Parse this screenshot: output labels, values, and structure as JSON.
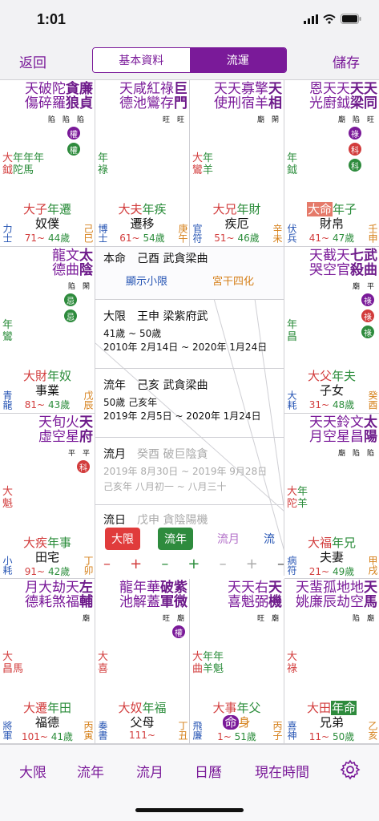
{
  "status": {
    "time": "1:01"
  },
  "nav": {
    "back": "返回",
    "save": "儲存",
    "seg": [
      "基本資料",
      "流運"
    ]
  },
  "cells": [
    {
      "id": "c0",
      "stars": [
        [
          "廉",
          "陷"
        ],
        [
          "貪",
          "陷"
        ],
        [
          "羅",
          "陷"
        ],
        [
          "破",
          ""
        ],
        [
          "天",
          ""
        ]
      ],
      "stars2": [
        [
          "貞",
          ""
        ],
        [
          "狼",
          ""
        ],
        [
          "碎",
          ""
        ],
        [
          "陀",
          ""
        ],
        [
          "傷",
          ""
        ]
      ],
      "badges": [
        "權",
        "權"
      ],
      "small": [
        "大年年年",
        "鉞陀馬"
      ],
      "palace": "大子年遷",
      "name": "奴僕",
      "age": "71~ 44歲",
      "bl": "力士",
      "br": "己巳"
    },
    {
      "id": "c1",
      "stars": [
        [
          "巨",
          "旺"
        ],
        [
          "祿",
          "旺"
        ],
        [
          "存",
          ""
        ],
        [
          "咸",
          ""
        ],
        [
          "天",
          ""
        ]
      ],
      "palace": "大夫年疾",
      "name": "遷移",
      "age": "61~ 54歲",
      "bl": "博士",
      "br": "庚午"
    },
    {
      "id": "c2",
      "stars": [
        [
          "天",
          "閑"
        ],
        [
          "相",
          "廟"
        ],
        [
          "擎",
          ""
        ],
        [
          "寡",
          ""
        ],
        [
          "天",
          ""
        ]
      ],
      "palace": "大兄年財",
      "name": "疾厄",
      "age": "51~ 46歲",
      "bl": "官符",
      "br": "辛未"
    },
    {
      "id": "c3",
      "stars": [
        [
          "天",
          "閑"
        ],
        [
          "同",
          "陷"
        ],
        [
          "天",
          "廟"
        ],
        [
          "梁",
          ""
        ],
        [
          "恩",
          ""
        ]
      ],
      "palace": "大命年子",
      "name": "財帛",
      "age": "41~ 47歲",
      "bl": "伏兵",
      "br": "壬申"
    },
    {
      "id": "c4",
      "stars": [
        [
          "太",
          "閑"
        ],
        [
          "陰",
          ""
        ],
        [
          "文",
          "陷"
        ],
        [
          "曲",
          ""
        ],
        [
          "龍",
          ""
        ]
      ],
      "palace": "大財年奴",
      "name": "事業",
      "age": "81~ 43歲",
      "bl": "青龍",
      "br": "戊辰"
    },
    {
      "id": "c5",
      "stars": [
        [
          "七",
          "廟"
        ],
        [
          "殺",
          ""
        ],
        [
          "武",
          "平"
        ],
        [
          "曲",
          ""
        ],
        [
          "天",
          ""
        ]
      ],
      "palace": "大父年夫",
      "name": "子女",
      "age": "31~ 48歲",
      "bl": "大耗",
      "br": "癸酉"
    },
    {
      "id": "c6",
      "stars": [
        [
          "天",
          "平"
        ],
        [
          "府",
          ""
        ],
        [
          "火",
          "平"
        ],
        [
          "星",
          ""
        ],
        [
          "天",
          ""
        ]
      ],
      "palace": "大疾年事",
      "name": "田宅",
      "age": "91~ 42歲",
      "bl": "小耗",
      "br": "丁卯"
    },
    {
      "id": "c7",
      "stars": [
        [
          "太",
          "平"
        ],
        [
          "陽",
          ""
        ],
        [
          "文",
          "陷"
        ],
        [
          "昌",
          ""
        ],
        [
          "天",
          ""
        ]
      ],
      "palace": "大福年兄",
      "name": "夫妻",
      "age": "21~ 49歲",
      "bl": "病符",
      "br": "甲戌"
    },
    {
      "id": "c8",
      "palace": "大遷年田",
      "name": "福德",
      "age": "101~ 41歲",
      "bl": "將軍",
      "br": "丙寅"
    },
    {
      "id": "c9",
      "palace": "大奴年福",
      "name": "父母",
      "age": "111~",
      "bl": "奏書",
      "br": "丁丑"
    },
    {
      "id": "c10",
      "palace": "大事年父",
      "name": "命身",
      "age": "1~ 51歲",
      "bl": "飛廉",
      "br": "丙子"
    },
    {
      "id": "c11",
      "palace": "大田年命",
      "name": "兄弟",
      "age": "11~ 50歲",
      "bl": "喜神",
      "br": "乙亥"
    }
  ],
  "center": {
    "benming": "本命　己酉 武貪梁曲",
    "show_small": "顯示小限",
    "palace_hua": "宮干四化",
    "daxian_title": "大限　王申 梁紫府武",
    "daxian_age": "41歲 ~ 50歲",
    "daxian_date": "2010年 2月14日 ~ 2020年 1月24日",
    "liunian_title": "流年　己亥 武貪梁曲",
    "liunian_age": "50歲 己亥年",
    "liunian_date": "2019年 2月5日 ~ 2020年 1月24日",
    "liuyue_title": "流月　癸酉 破巨陰貪",
    "liuyue_date": "2019年 8月30日 ~ 2019年 9月28日",
    "liuyue_lunar": "己亥年 八月初一 ~ 八月三十",
    "liuri_title": "流日　戊申 貪陰陽機",
    "btn_daxian": "大限",
    "btn_liunian": "流年",
    "btn_liuyue": "流月",
    "btn_liu": "流"
  },
  "tabs": [
    "大限",
    "流年",
    "流月",
    "日曆",
    "現在時間"
  ]
}
